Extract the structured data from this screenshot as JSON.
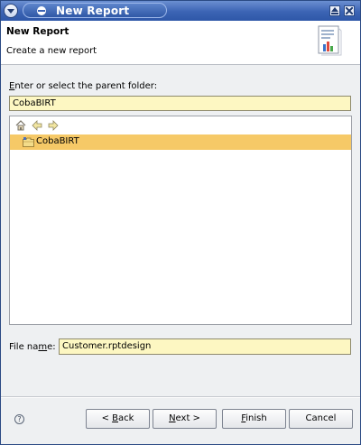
{
  "window": {
    "title": "New Report"
  },
  "banner": {
    "title": "New Report",
    "description": "Create a new report"
  },
  "parent_folder": {
    "label_prefix": "",
    "label_mnemonic": "E",
    "label_rest": "nter or select the parent folder:",
    "value": "CobaBIRT"
  },
  "tree": {
    "toolbar": [
      "home-icon",
      "back-arrow-icon",
      "forward-arrow-icon"
    ],
    "items": [
      {
        "label": "CobaBIRT",
        "selected": true
      }
    ]
  },
  "file_name": {
    "label_prefix": "File na",
    "label_mnemonic": "m",
    "label_rest": "e:",
    "value": "Customer.rptdesign"
  },
  "buttons": {
    "help": "?",
    "back": {
      "prefix": "< ",
      "mnemonic": "B",
      "rest": "ack"
    },
    "next": {
      "prefix": "",
      "mnemonic": "N",
      "rest": "ext >"
    },
    "finish": {
      "prefix": "",
      "mnemonic": "F",
      "rest": "inish"
    },
    "cancel": {
      "prefix": "Cancel",
      "mnemonic": "",
      "rest": ""
    }
  },
  "colors": {
    "titlebar": "#3c64b4",
    "input_bg": "#fdf7c2",
    "selection": "#f6c967"
  }
}
